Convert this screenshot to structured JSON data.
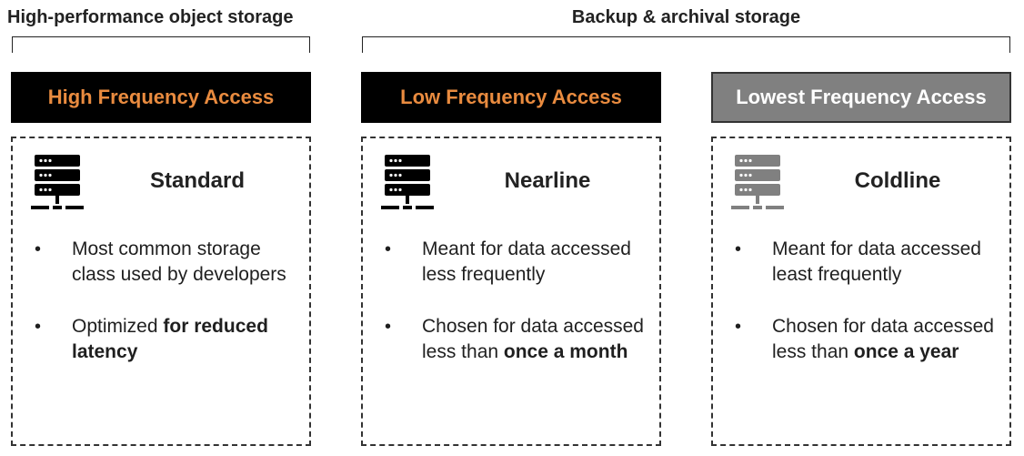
{
  "groups": [
    {
      "label": "High-performance object storage"
    },
    {
      "label": "Backup & archival storage"
    }
  ],
  "colors": {
    "accent": "#e98b3f",
    "dark_header": "#000000",
    "gray_header": "#808080",
    "icon_dark": "#000000",
    "icon_gray": "#808080"
  },
  "tiers": [
    {
      "header": "High Frequency Access",
      "icon": "server-icon",
      "title": "Standard",
      "bullets": [
        {
          "text": "Most common storage class used by developers",
          "bold": ""
        },
        {
          "text": "Optimized ",
          "bold": "for reduced latency"
        }
      ]
    },
    {
      "header": "Low Frequency Access",
      "icon": "server-icon",
      "title": "Nearline",
      "bullets": [
        {
          "text": "Meant for data accessed less frequently",
          "bold": ""
        },
        {
          "text": "Chosen for data accessed less than ",
          "bold": "once a month"
        }
      ]
    },
    {
      "header": "Lowest Frequency Access",
      "icon": "server-icon",
      "title": "Coldline",
      "bullets": [
        {
          "text": "Meant for data accessed least frequently",
          "bold": ""
        },
        {
          "text": "Chosen for data accessed less than ",
          "bold": "once a year"
        }
      ]
    }
  ]
}
